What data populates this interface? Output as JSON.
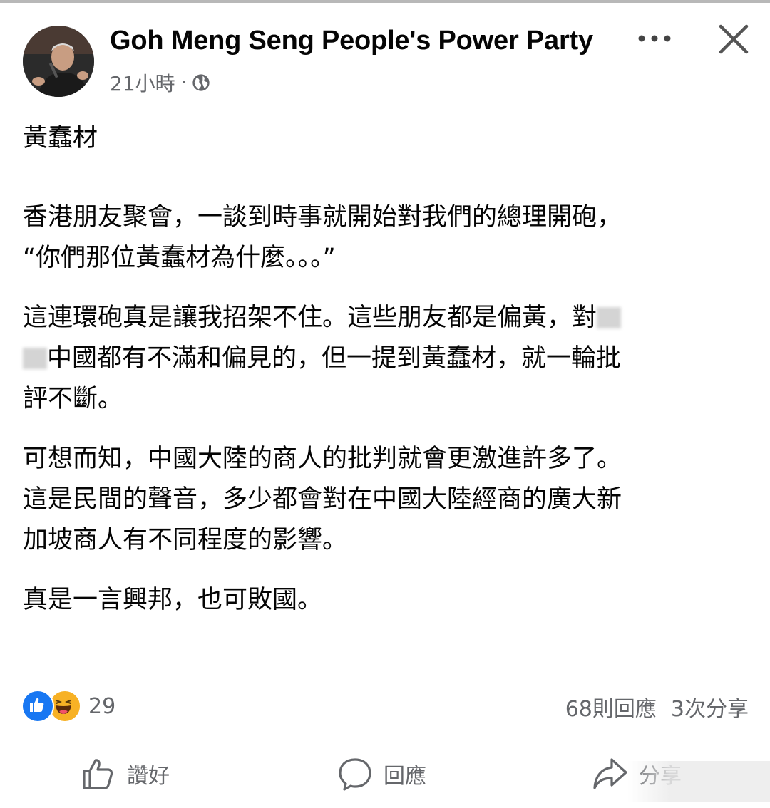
{
  "post": {
    "author": "Goh Meng Seng People's Power Party",
    "time": "21小時",
    "separator": "·",
    "privacy_icon": "globe-icon"
  },
  "header_icons": {
    "more": "more-icon",
    "close": "close-icon"
  },
  "body": {
    "title": "黃蠢材",
    "p1_line1": "香港朋友聚會，一談到時事就開始對我們的總理開砲，",
    "p1_line2": "“你們那位黃蠢材為什麼。。。”",
    "p2_line1": "這連環砲真是讓我招架不住。這些朋友都是偏黃，對",
    "p2_line2": "中國都有不滿和偏見的，但一提到黃蠢材，就一輪批",
    "p2_line3": "評不斷。",
    "p3_line1": "可想而知，中國大陸的商人的批判就會更激進許多了。",
    "p3_line2": "這是民間的聲音，多少都會對在中國大陸經商的廣大新",
    "p3_line3": "加坡商人有不同程度的影響。",
    "p4": "真是一言興邦，也可敗國。"
  },
  "stats": {
    "reactions": [
      "like",
      "haha"
    ],
    "reaction_count": "29",
    "comments": "68則回應",
    "shares": "3次分享"
  },
  "actions": {
    "like": "讚好",
    "comment": "回應",
    "share": "分享"
  },
  "colors": {
    "text": "#050505",
    "secondary": "#65676b",
    "like_blue": "#1877f2",
    "haha_yellow": "#f7b125"
  }
}
